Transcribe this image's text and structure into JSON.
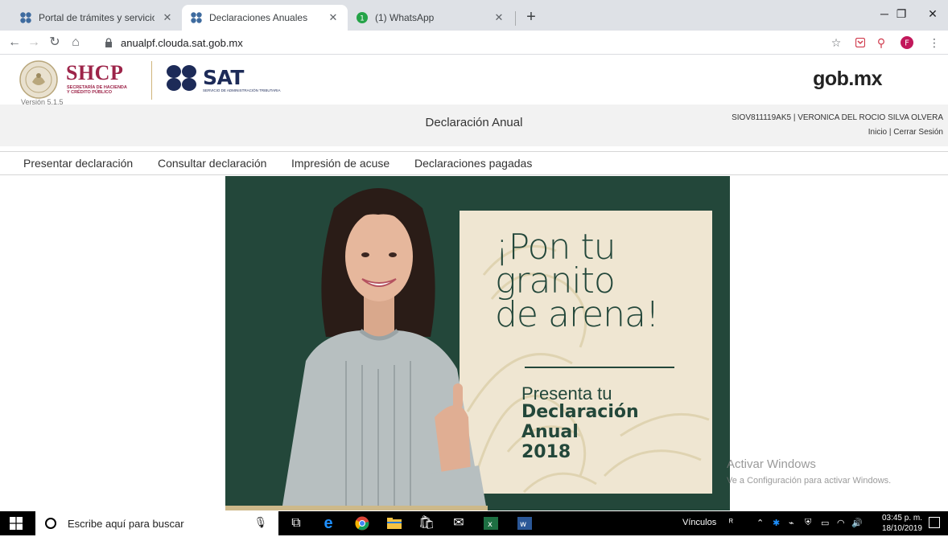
{
  "browser": {
    "tabs": [
      {
        "title": "Portal de trámites y servicios - SA",
        "active": false
      },
      {
        "title": "Declaraciones Anuales",
        "active": true
      },
      {
        "title": "(1) WhatsApp",
        "active": false
      }
    ],
    "url": "anualpf.clouda.sat.gob.mx",
    "profile_initial": "F"
  },
  "header": {
    "shcp": "SHCP",
    "shcp_sub1": "SECRETARÍA DE HACIENDA",
    "shcp_sub2": "Y CRÉDITO PÚBLICO",
    "sat": "SAT",
    "sat_sub": "SERVICIO DE ADMINISTRACIÓN TRIBUTARIA",
    "version": "Versión 5.1.5",
    "gob": "gob.mx"
  },
  "titlebar": {
    "title": "Declaración Anual",
    "user": "SIOV811119AK5 | VERONICA DEL ROCIO SILVA OLVERA",
    "inicio": "Inicio",
    "sep": "|",
    "cerrar": "Cerrar Sesión"
  },
  "menu": {
    "items": [
      "Presentar declaración",
      "Consultar declaración",
      "Impresión de acuse",
      "Declaraciones pagadas"
    ]
  },
  "banner": {
    "line1": "¡Pon tu",
    "line2": "granito",
    "line3": "de arena!",
    "sub1": "Presenta tu",
    "sub2": "Declaración",
    "sub3": "Anual",
    "sub4": "2018"
  },
  "watermark": {
    "line1": "Activar Windows",
    "line2": "Ve a Configuración para activar Windows."
  },
  "taskbar": {
    "search_placeholder": "Escribe aquí para buscar",
    "links": "Vínculos",
    "time": "03:45 p. m.",
    "date": "18/10/2019"
  },
  "colors": {
    "shcp": "#9d2449",
    "sat": "#1d2b58",
    "banner_green": "#23473a",
    "banner_card": "#efe6d2"
  }
}
